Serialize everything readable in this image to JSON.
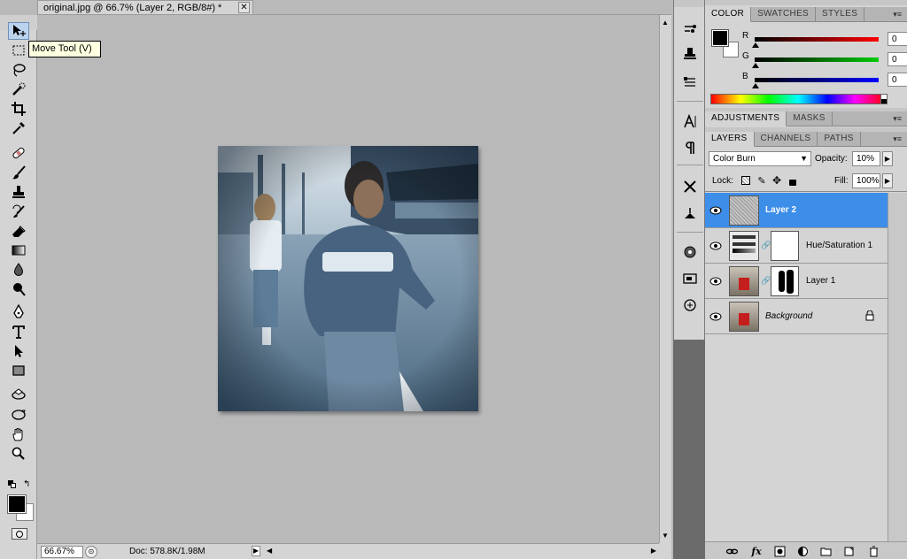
{
  "document": {
    "tab_title": "original.jpg @ 66.7% (Layer 2, RGB/8#) *",
    "close_glyph": "✕"
  },
  "tooltip": "Move Tool (V)",
  "status": {
    "zoom": "66.67%",
    "doc_info": "Doc: 578.8K/1.98M"
  },
  "tools": [
    {
      "name": "move-tool",
      "icon": "move-icon",
      "active": true
    },
    {
      "name": "marquee-tool",
      "icon": "marquee-icon"
    },
    {
      "name": "lasso-tool",
      "icon": "lasso-icon"
    },
    {
      "name": "quick-selection-tool",
      "icon": "quick-selection-icon"
    },
    {
      "name": "crop-tool",
      "icon": "crop-icon"
    },
    {
      "name": "eyedropper-tool",
      "icon": "eyedropper-icon"
    },
    {
      "name": "healing-brush-tool",
      "icon": "bandage-icon"
    },
    {
      "name": "brush-tool",
      "icon": "brush-icon"
    },
    {
      "name": "clone-stamp-tool",
      "icon": "stamp-icon"
    },
    {
      "name": "history-brush-tool",
      "icon": "history-brush-icon"
    },
    {
      "name": "eraser-tool",
      "icon": "eraser-icon"
    },
    {
      "name": "gradient-tool",
      "icon": "gradient-icon"
    },
    {
      "name": "blur-tool",
      "icon": "drop-icon"
    },
    {
      "name": "dodge-tool",
      "icon": "dodge-icon"
    },
    {
      "name": "pen-tool",
      "icon": "pen-icon"
    },
    {
      "name": "type-tool",
      "icon": "type-icon"
    },
    {
      "name": "path-selection-tool",
      "icon": "arrow-icon"
    },
    {
      "name": "shape-tool",
      "icon": "rectangle-icon"
    },
    {
      "name": "3d-rotate-tool",
      "icon": "3d-rotate-icon"
    },
    {
      "name": "3d-orbit-tool",
      "icon": "3d-orbit-icon"
    },
    {
      "name": "hand-tool",
      "icon": "hand-icon"
    },
    {
      "name": "zoom-tool",
      "icon": "magnifier-icon"
    }
  ],
  "color_panel": {
    "tabs": [
      "COLOR",
      "SWATCHES",
      "STYLES"
    ],
    "active_tab": "COLOR",
    "foreground": "#000000",
    "background": "#ffffff",
    "sliders": [
      {
        "label": "R",
        "value": "0",
        "color": "#ff0000"
      },
      {
        "label": "G",
        "value": "0",
        "color": "#00c000"
      },
      {
        "label": "B",
        "value": "0",
        "color": "#0000ff"
      }
    ]
  },
  "adjustments_panel": {
    "tabs": [
      "ADJUSTMENTS",
      "MASKS"
    ],
    "active_tab": "ADJUSTMENTS"
  },
  "layers_panel": {
    "tabs": [
      "LAYERS",
      "CHANNELS",
      "PATHS"
    ],
    "active_tab": "LAYERS",
    "blend_mode": "Color Burn",
    "opacity_label": "Opacity:",
    "opacity": "10%",
    "lock_label": "Lock:",
    "fill_label": "Fill:",
    "fill": "100%",
    "layers": [
      {
        "name": "Layer 2",
        "selected": true,
        "visible": true
      },
      {
        "name": "Hue/Saturation 1",
        "selected": false,
        "visible": true
      },
      {
        "name": "Layer 1",
        "selected": false,
        "visible": true
      },
      {
        "name": "Background",
        "selected": false,
        "visible": true,
        "locked": true,
        "italic": true
      }
    ]
  },
  "panel_menu_glyph": "▾≡",
  "accent_color": "#3d8ee9"
}
